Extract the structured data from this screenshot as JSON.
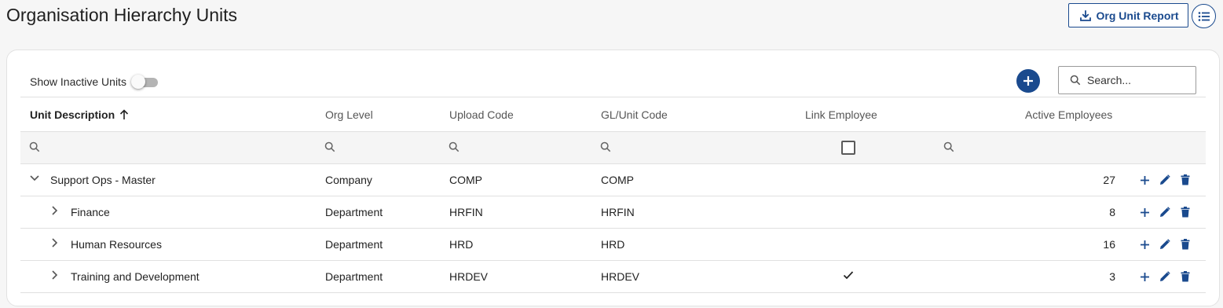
{
  "page": {
    "title": "Organisation Hierarchy Units",
    "report_button_label": "Org Unit Report"
  },
  "toolbar": {
    "show_inactive_label": "Show Inactive Units",
    "show_inactive_on": false,
    "search_placeholder": "Search..."
  },
  "table": {
    "columns": {
      "unit_description": "Unit Description",
      "org_level": "Org Level",
      "upload_code": "Upload Code",
      "gl_unit_code": "GL/Unit Code",
      "link_employee": "Link Employee",
      "active_employees": "Active Employees"
    },
    "rows": [
      {
        "name": "Support Ops - Master",
        "level": "Company",
        "upload": "COMP",
        "gl": "COMP",
        "link": false,
        "active": "27",
        "expanded": true,
        "depth": 0
      },
      {
        "name": "Finance",
        "level": "Department",
        "upload": "HRFIN",
        "gl": "HRFIN",
        "link": false,
        "active": "8",
        "expanded": false,
        "depth": 1
      },
      {
        "name": "Human Resources",
        "level": "Department",
        "upload": "HRD",
        "gl": "HRD",
        "link": false,
        "active": "16",
        "expanded": false,
        "depth": 1
      },
      {
        "name": "Training and Development",
        "level": "Department",
        "upload": "HRDEV",
        "gl": "HRDEV",
        "link": true,
        "active": "3",
        "expanded": false,
        "depth": 1
      }
    ]
  },
  "colors": {
    "accent": "#1a4a8e",
    "border": "#e0e0e0"
  }
}
